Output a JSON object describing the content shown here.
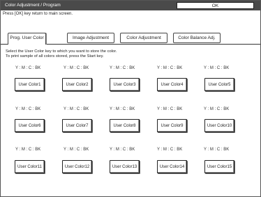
{
  "title": "Color Adjustment / Program",
  "ok_label": "OK",
  "hint": "Press [OK] key return to main screen.",
  "tabs": [
    {
      "label": "Prog. User Color"
    },
    {
      "label": "Image Adjustment"
    },
    {
      "label": "Color Adjustment"
    },
    {
      "label": "Color Balance Adj."
    }
  ],
  "instructions": {
    "line1": "Select the User Color key to which you want to store the color.",
    "line2": "To print sample of all colors stored, press the Start key."
  },
  "cmyk_label": "Y : M : C : BK",
  "user_colors": [
    {
      "label": "User Color1"
    },
    {
      "label": "User Color2"
    },
    {
      "label": "User Color3"
    },
    {
      "label": "User Color4"
    },
    {
      "label": "User Color5"
    },
    {
      "label": "User Color6"
    },
    {
      "label": "User Color7"
    },
    {
      "label": "User Color8"
    },
    {
      "label": "User Color9"
    },
    {
      "label": "User Color10"
    },
    {
      "label": "User Color11"
    },
    {
      "label": "User Color12"
    },
    {
      "label": "User Color13"
    },
    {
      "label": "User Color14"
    },
    {
      "label": "User Color15"
    }
  ]
}
